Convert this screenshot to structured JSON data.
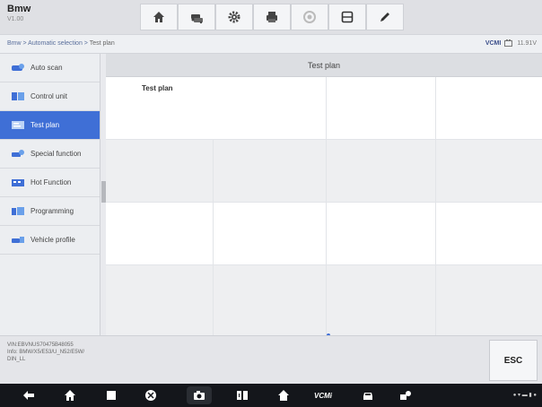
{
  "app": {
    "title": "Bmw",
    "version": "V1.00"
  },
  "toolbar": {
    "buttons": [
      {
        "name": "home",
        "icon": "home-icon"
      },
      {
        "name": "vehicle",
        "icon": "vehicle-swap-icon"
      },
      {
        "name": "settings",
        "icon": "gear-icon"
      },
      {
        "name": "print",
        "icon": "printer-icon"
      },
      {
        "name": "help",
        "icon": "help-icon"
      },
      {
        "name": "save",
        "icon": "save-icon"
      },
      {
        "name": "edit",
        "icon": "pen-icon"
      }
    ]
  },
  "breadcrumb": {
    "trail": "Bmw > Automatic selection > ",
    "current": "Test plan"
  },
  "status": {
    "vci": "VCMI",
    "voltage": "11.91V"
  },
  "sidebar": {
    "items": [
      {
        "label": "Auto scan",
        "active": false
      },
      {
        "label": "Control unit",
        "active": false
      },
      {
        "label": "Test plan",
        "active": true
      },
      {
        "label": "Special function",
        "active": false
      },
      {
        "label": "Hot Function",
        "active": false
      },
      {
        "label": "Programming",
        "active": false
      },
      {
        "label": "Vehicle profile",
        "active": false
      }
    ]
  },
  "main": {
    "header": "Test plan",
    "rows": [
      {
        "label": "Test plan"
      }
    ]
  },
  "info": {
    "vin": "VIN:EBVNUS70475B48055",
    "line2": "Info: BMW/X5/E53/U_N52/E5W/",
    "line3": "DIN_LL"
  },
  "esc": {
    "label": "ESC"
  },
  "navbar": {
    "vcm": "VCMi"
  },
  "colors": {
    "accent": "#3f6fd6",
    "navbar": "#14161b"
  }
}
